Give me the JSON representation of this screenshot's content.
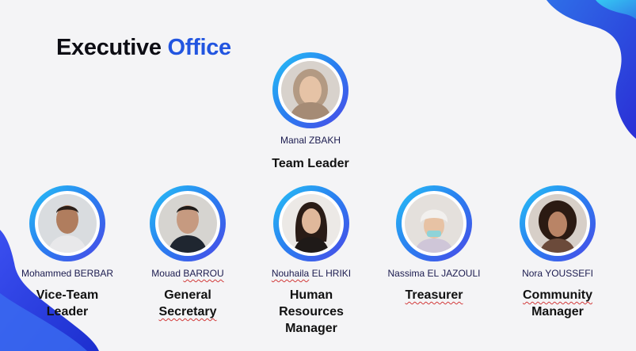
{
  "slide": {
    "title_word1": "Executive",
    "title_word2": "Office"
  },
  "members": [
    {
      "name_first": "Manal",
      "name_last": "ZBAKH",
      "role": "Team Leader",
      "avatar": "woman-hijab-portrait"
    },
    {
      "name_first": "Mohammed",
      "name_last": "BERBAR",
      "role": "Vice-Team Leader",
      "avatar": "man-portrait"
    },
    {
      "name_first": "Mouad",
      "name_last": "BARROU",
      "role_line1": "General",
      "role_line2": "Secretary",
      "avatar": "man-portrait"
    },
    {
      "name_first": "Nouhaila",
      "name_last": "EL HRIKI",
      "role_line1": "Human",
      "role_line2": "Resources",
      "role_line3": "Manager",
      "avatar": "woman-portrait"
    },
    {
      "name_first": "Nassima",
      "name_last": "EL JAZOULI",
      "role": "Treasurer",
      "avatar": "woman-beanie-portrait"
    },
    {
      "name_first": "Nora",
      "name_last": "YOUSSEFI",
      "role_line1": "Community",
      "role_line2": "Manager",
      "avatar": "woman-curly-hair-portrait"
    }
  ],
  "colors": {
    "title_dark": "#0d0d14",
    "title_accent": "#2255e0",
    "ring_start": "#27c2f5",
    "ring_end": "#4b48e6",
    "wave_blue": "#2b3fdc"
  }
}
